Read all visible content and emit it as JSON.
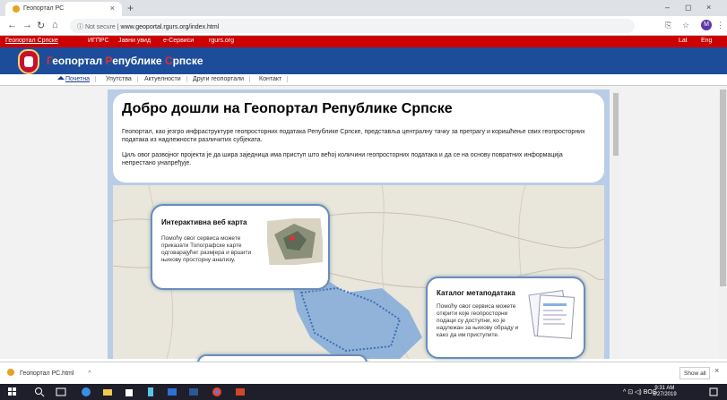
{
  "browser": {
    "tab_title": "Геопортал РС",
    "tab_close": "×",
    "new_tab": "+",
    "url_security": "Not secure",
    "url": "www.geoportal.rgurs.org/index.html",
    "min": "–",
    "max": "◻",
    "close": "×"
  },
  "top_nav": {
    "items": [
      "Геопортал Српске",
      "ИГПРС",
      "Јавни увид",
      "е-Сервиси",
      "rgurs.org"
    ],
    "lang": [
      "Lat",
      "Eng"
    ]
  },
  "header": {
    "title_parts": [
      "Г",
      "еопортал ",
      "Р",
      "епублике ",
      "С",
      "рпске"
    ]
  },
  "menu": {
    "items": [
      "Почетна",
      "Упутства",
      "Актуелности",
      "Други геопортали",
      "Контакт"
    ]
  },
  "intro": {
    "heading": "Добро дошли на Геопортал Републике Српске",
    "p1": "Геопортал, као језгро инфраструктуре геопросторних података Републике Српске, представља централну тачку за претрагу и коришћење свих геопросторних података из надлежности различитих субјеката.",
    "p2": "Циљ овог развојног пројекта је да шира заједница има приступ што већој количини геопросторних података и да се на основу повратних информација непрестано унапређује."
  },
  "cards": {
    "web_map": {
      "title": "Интерактивна веб карта",
      "text": "Помоћу овог сервиса можете приказати Топографске карте одговарајућег размјера и вршити њихову просторну анализу."
    },
    "catalog": {
      "title": "Каталог метаподатака",
      "text": "Помоћу овог сервиса можете открити које геопросторни подаци су доступни, ко је надлежан за њихову обраду и како да им приступите."
    }
  },
  "downloads": {
    "file": "Геопортал РС.html",
    "show_all": "Show all",
    "close": "×"
  },
  "taskbar": {
    "time": "9:31 AM",
    "date": "6/27/2019",
    "lang": "BOS"
  }
}
